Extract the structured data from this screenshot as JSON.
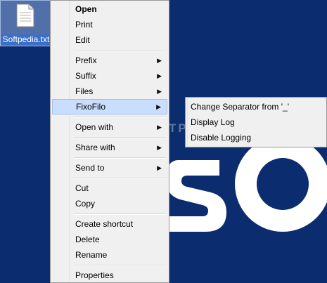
{
  "desktop": {
    "file_label": "Softpedia.txt",
    "watermark": "SOFTPEDIA"
  },
  "context_menu": {
    "items": [
      {
        "label": "Open"
      },
      {
        "label": "Print"
      },
      {
        "label": "Edit"
      },
      {
        "label": "Prefix"
      },
      {
        "label": "Suffix"
      },
      {
        "label": "Files"
      },
      {
        "label": "FixoFilo"
      },
      {
        "label": "Open with"
      },
      {
        "label": "Share with"
      },
      {
        "label": "Send to"
      },
      {
        "label": "Cut"
      },
      {
        "label": "Copy"
      },
      {
        "label": "Create shortcut"
      },
      {
        "label": "Delete"
      },
      {
        "label": "Rename"
      },
      {
        "label": "Properties"
      }
    ]
  },
  "submenu": {
    "items": [
      {
        "label": "Change Separator from '_'"
      },
      {
        "label": "Display Log"
      },
      {
        "label": "Disable Logging"
      }
    ]
  },
  "colors": {
    "desktop_background": "#0b2c6e",
    "menu_background": "#f0f0f0",
    "highlight": "#c9defc"
  }
}
